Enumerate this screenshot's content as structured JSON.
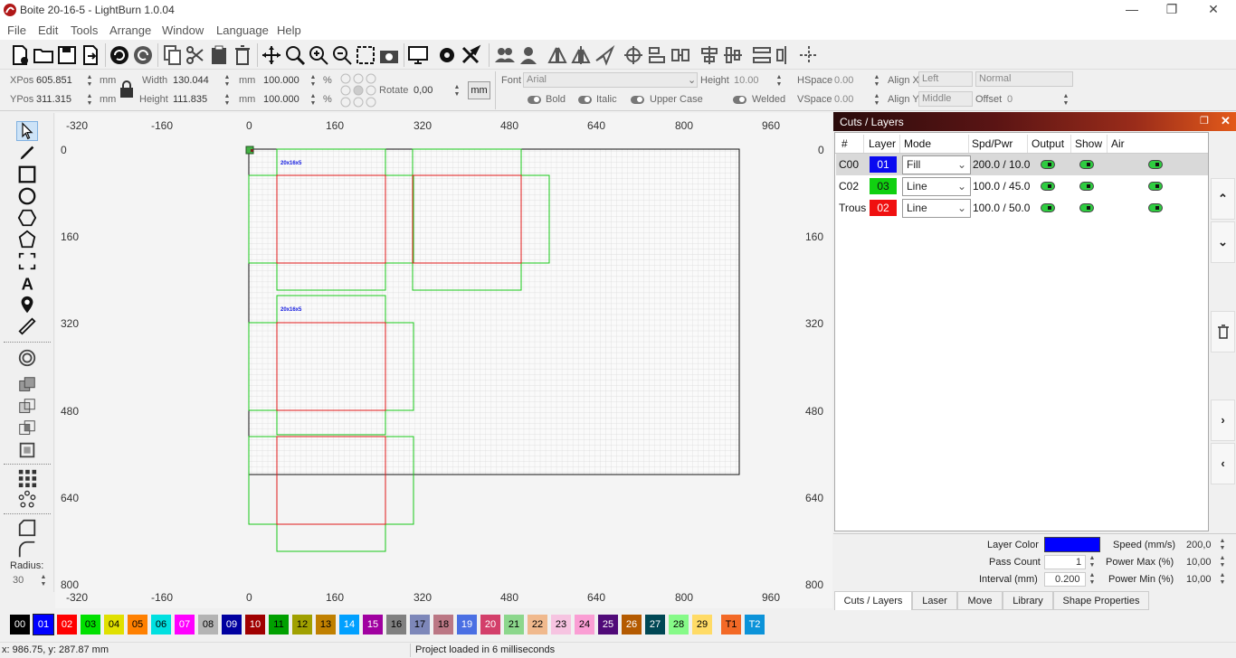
{
  "window": {
    "title": "Boite 20-16-5 - LightBurn 1.0.04"
  },
  "menu": [
    "File",
    "Edit",
    "Tools",
    "Arrange",
    "Window",
    "Language",
    "Help"
  ],
  "props": {
    "xpos_label": "XPos",
    "xpos": "605.851",
    "ypos_label": "YPos",
    "ypos": "311.315",
    "unit": "mm",
    "width_label": "Width",
    "width": "130.044",
    "height_label": "Height",
    "height": "111.835",
    "scale_w": "100.000",
    "scale_h": "100.000",
    "pct": "%",
    "rotate_label": "Rotate",
    "rotate": "0,00",
    "mm_button": "mm",
    "font_label": "Font",
    "font": "Arial",
    "fheight_label": "Height",
    "fheight": "10.00",
    "hspace_label": "HSpace",
    "hspace": "0.00",
    "vspace_label": "VSpace",
    "vspace": "0.00",
    "alignx_label": "Align X",
    "alignx": "Left",
    "aligny_label": "Align Y",
    "aligny": "Middle",
    "style": "Normal",
    "offset_label": "Offset",
    "offset": "0",
    "bold": "Bold",
    "italic": "Italic",
    "upper": "Upper Case",
    "welded": "Welded"
  },
  "left_tools": {
    "radius_label": "Radius:",
    "radius": "30"
  },
  "canvas": {
    "ruler_x": [
      "-320",
      "-160",
      "0",
      "160",
      "320",
      "480",
      "640",
      "800",
      "960"
    ],
    "ruler_y": [
      "0",
      "160",
      "320",
      "480",
      "640",
      "800"
    ],
    "ruler_y_right": [
      "0",
      "160",
      "320",
      "480",
      "640",
      "800"
    ],
    "text1": "20x16x5",
    "text2": "20x16x5"
  },
  "cuts": {
    "title": "Cuts / Layers",
    "headers": [
      "#",
      "Layer",
      "Mode",
      "Spd/Pwr",
      "Output",
      "Show",
      "Air"
    ],
    "rows": [
      {
        "name": "C00",
        "layer": "01",
        "color": "#0a0af0",
        "mode": "Fill",
        "spdpwr": "200.0 / 10.0"
      },
      {
        "name": "C02",
        "layer": "03",
        "color": "#10d010",
        "mode": "Line",
        "spdpwr": "100.0 / 45.0"
      },
      {
        "name": "Trous",
        "layer": "02",
        "color": "#f01010",
        "mode": "Line",
        "spdpwr": "100.0 / 50.0"
      }
    ],
    "layer_color_label": "Layer Color",
    "layer_color": "#0000ff",
    "pass_label": "Pass Count",
    "pass": "1",
    "interval_label": "Interval (mm)",
    "interval": "0.200",
    "speed_label": "Speed (mm/s)",
    "speed": "200,0",
    "pmax_label": "Power Max (%)",
    "pmax": "10,00",
    "pmin_label": "Power Min (%)",
    "pmin": "10,00",
    "tabs": [
      "Cuts / Layers",
      "Laser",
      "Move",
      "Library",
      "Shape Properties"
    ]
  },
  "palette": [
    {
      "id": "00",
      "bg": "#000000",
      "fg": "#ffffff"
    },
    {
      "id": "01",
      "bg": "#0000ff",
      "fg": "#ffffff"
    },
    {
      "id": "02",
      "bg": "#ff0000",
      "fg": "#ffffff"
    },
    {
      "id": "03",
      "bg": "#00e000",
      "fg": "#000000"
    },
    {
      "id": "04",
      "bg": "#e0e000",
      "fg": "#000000"
    },
    {
      "id": "05",
      "bg": "#ff8000",
      "fg": "#000000"
    },
    {
      "id": "06",
      "bg": "#00e0e0",
      "fg": "#000000"
    },
    {
      "id": "07",
      "bg": "#ff00ff",
      "fg": "#ffffff"
    },
    {
      "id": "08",
      "bg": "#b4b4b4",
      "fg": "#000000"
    },
    {
      "id": "09",
      "bg": "#0000a0",
      "fg": "#ffffff"
    },
    {
      "id": "10",
      "bg": "#a00000",
      "fg": "#ffffff"
    },
    {
      "id": "11",
      "bg": "#00a000",
      "fg": "#000000"
    },
    {
      "id": "12",
      "bg": "#a0a000",
      "fg": "#000000"
    },
    {
      "id": "13",
      "bg": "#c08000",
      "fg": "#000000"
    },
    {
      "id": "14",
      "bg": "#00a0ff",
      "fg": "#ffffff"
    },
    {
      "id": "15",
      "bg": "#a000a0",
      "fg": "#ffffff"
    },
    {
      "id": "16",
      "bg": "#808080",
      "fg": "#000000"
    },
    {
      "id": "17",
      "bg": "#7d87b9",
      "fg": "#000000"
    },
    {
      "id": "18",
      "bg": "#bb7784",
      "fg": "#000000"
    },
    {
      "id": "19",
      "bg": "#4a6fe3",
      "fg": "#ffffff"
    },
    {
      "id": "20",
      "bg": "#d33f6a",
      "fg": "#ffffff"
    },
    {
      "id": "21",
      "bg": "#8cd78c",
      "fg": "#000000"
    },
    {
      "id": "22",
      "bg": "#f0b98d",
      "fg": "#000000"
    },
    {
      "id": "23",
      "bg": "#f6c4e1",
      "fg": "#000000"
    },
    {
      "id": "24",
      "bg": "#fa9ed4",
      "fg": "#000000"
    },
    {
      "id": "25",
      "bg": "#500a78",
      "fg": "#ffffff"
    },
    {
      "id": "26",
      "bg": "#b45a00",
      "fg": "#ffffff"
    },
    {
      "id": "27",
      "bg": "#004754",
      "fg": "#ffffff"
    },
    {
      "id": "28",
      "bg": "#86fa88",
      "fg": "#000000"
    },
    {
      "id": "29",
      "bg": "#ffdb66",
      "fg": "#000000"
    },
    {
      "id": "T1",
      "bg": "#f36926",
      "fg": "#000000"
    },
    {
      "id": "T2",
      "bg": "#0c93d9",
      "fg": "#ffffff"
    }
  ],
  "status": {
    "coords": "x: 986.75, y: 287.87 mm",
    "message": "Project loaded in 6 milliseconds"
  }
}
